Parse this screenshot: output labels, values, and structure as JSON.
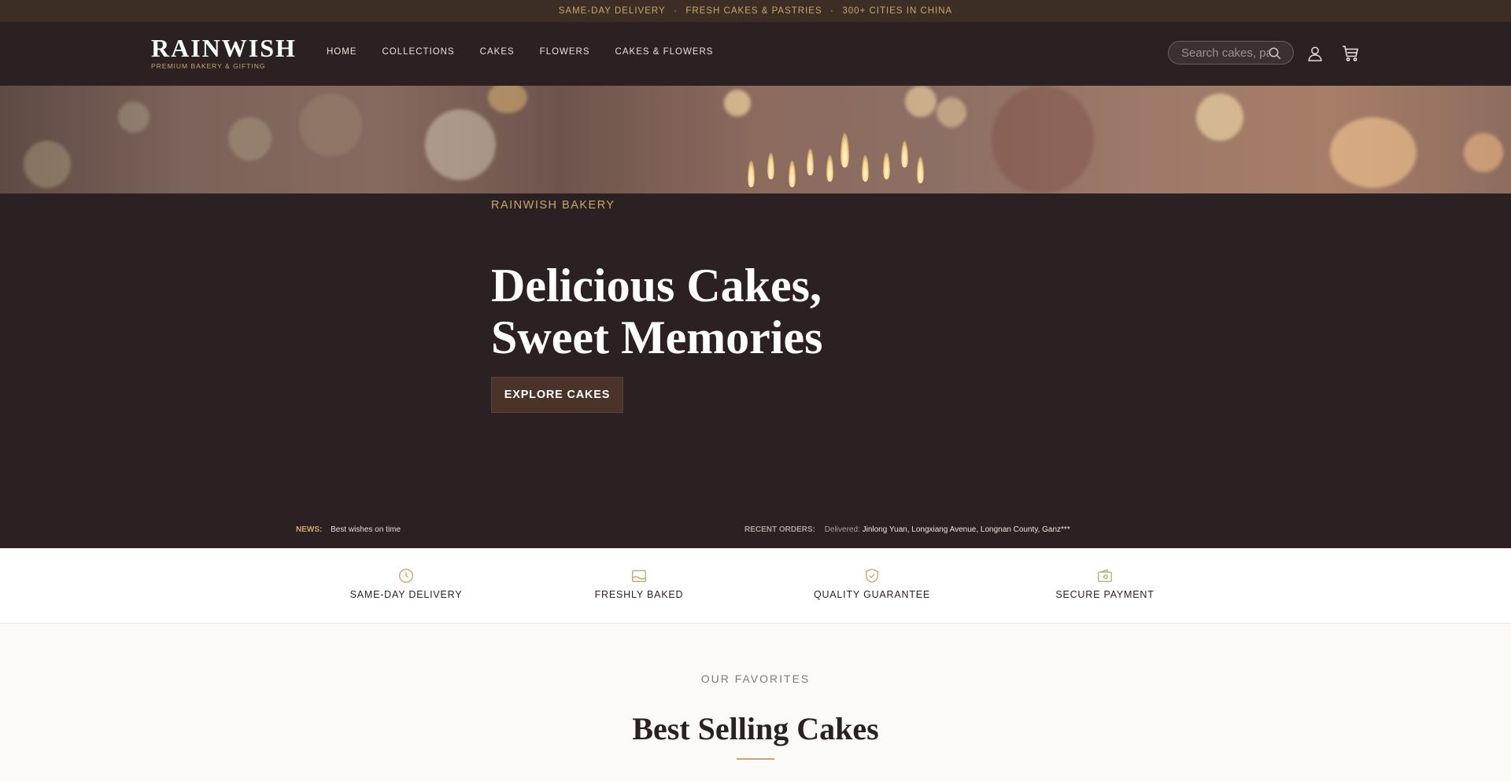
{
  "announcement": {
    "items": [
      "SAME-DAY DELIVERY",
      "FRESH CAKES & PASTRIES",
      "300+ CITIES IN CHINA"
    ],
    "separator": "·"
  },
  "header": {
    "logo": {
      "name": "RAINWISH",
      "tagline": "PREMIUM BAKERY & GIFTING"
    },
    "nav": [
      "HOME",
      "COLLECTIONS",
      "CAKES",
      "FLOWERS",
      "CAKES & FLOWERS"
    ],
    "search": {
      "placeholder": "Search cakes, pastries..."
    },
    "icons": {
      "search": "search-icon",
      "account": "user-icon",
      "cart": "cart-icon"
    }
  },
  "hero": {
    "eyebrow": "RAINWISH BAKERY",
    "title_line1": "Delicious Cakes,",
    "title_line2": "Sweet Memories",
    "cta": "EXPLORE CAKES"
  },
  "ticker": {
    "news_label": "NEWS:",
    "news_text": "Best wishes on time",
    "orders_label": "RECENT ORDERS:",
    "orders_prefix": "Delivered:",
    "orders_text": "Jinlong Yuan, Longxiang Avenue, Longnan County, Ganz***"
  },
  "features": [
    {
      "icon": "clock-icon",
      "label": "SAME-DAY DELIVERY"
    },
    {
      "icon": "tray-icon",
      "label": "FRESHLY BAKED"
    },
    {
      "icon": "shield-check-icon",
      "label": "QUALITY GUARANTEE"
    },
    {
      "icon": "wallet-icon",
      "label": "SECURE PAYMENT"
    }
  ],
  "favorites": {
    "eyebrow": "OUR FAVORITES",
    "title": "Best Selling Cakes"
  },
  "colors": {
    "gold": "#c9a66b",
    "dark": "#2c2122",
    "topbar": "#3d2e25",
    "cta": "#4a3429"
  }
}
